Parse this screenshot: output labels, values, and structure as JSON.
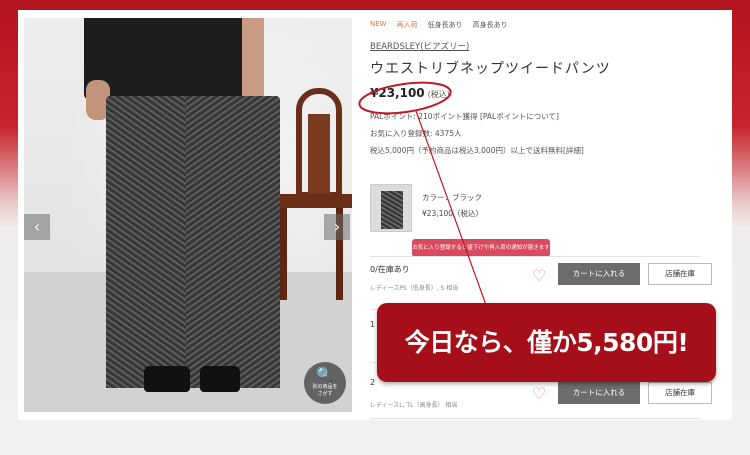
{
  "product": {
    "tags": [
      "NEW",
      "再入荷",
      "低身長あり",
      "高身長あり"
    ],
    "brand": "BEARDSLEY(ビアズリー)",
    "name": "ウエストリブネップツイードパンツ",
    "price": "¥23,100",
    "price_tax": "(税込)",
    "points": "PALポイント: 210ポイント獲得 [PALポイントについて]",
    "favorites": "お気に入り登録数: 4375人",
    "shipping": "税込5,000円（予約商品は税込3,000円）以上で送料無料[詳細]"
  },
  "gallery": {
    "prev_icon": "‹",
    "next_icon": "›",
    "zoom_icon": "🔍",
    "zoom_label": "別の商品を\nさがす"
  },
  "variant": {
    "color_label": "カラー：ブラック",
    "price": "¥23,100（税込）"
  },
  "tooltip": "お気に入り登録すると値下げや再入荷の通知が届きます",
  "rows": [
    {
      "stock": "0/在庫あり",
      "sizes": "レディースPS（低身長）, S 相当",
      "cart_label": "カートに入れる",
      "store_label": "店舗在庫",
      "heart_icon": "♡"
    },
    {
      "stock": "1",
      "sizes": "",
      "cart_label": "",
      "store_label": "",
      "heart_icon": ""
    },
    {
      "stock": "2",
      "sizes": "レディースL, TL（高身長） 相当",
      "cart_label": "カートに入れる",
      "store_label": "店舗在庫",
      "heart_icon": "♡"
    }
  ],
  "banner": {
    "text": "今日なら、僅か5,580円!"
  },
  "colors": {
    "accent_red": "#a60f19",
    "tooltip_pink": "#d9495f",
    "tag_orange": "#e07a2f",
    "cart_gray": "#6c6c6c"
  }
}
